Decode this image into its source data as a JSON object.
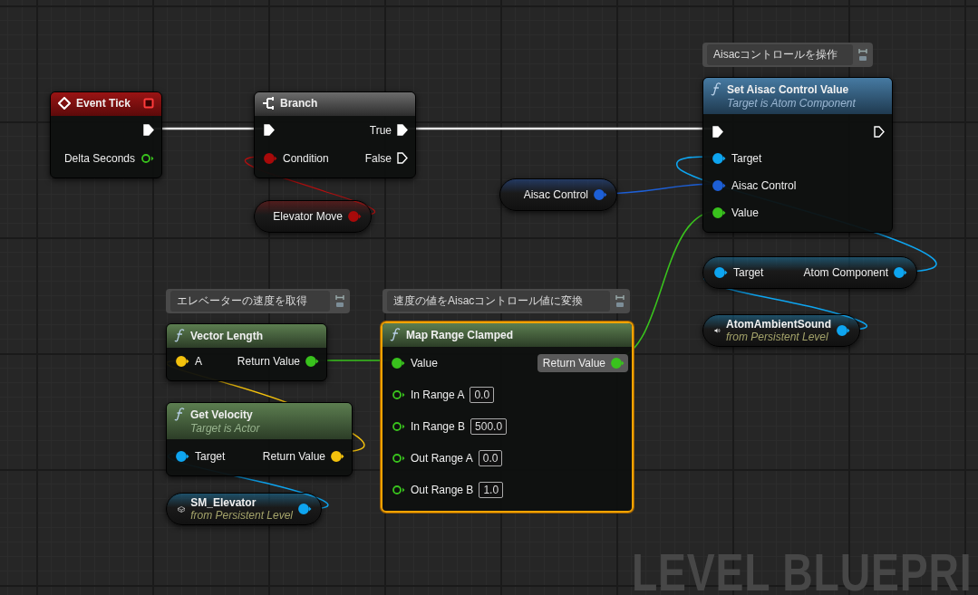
{
  "graph": {
    "comments": [
      {
        "text": "Aisacコントロールを操作"
      },
      {
        "text": "エレベーターの速度を取得"
      },
      {
        "text": "速度の値をAisacコントロール値に変換"
      }
    ],
    "nodes": [
      {
        "kind": "event",
        "title": "Event Tick",
        "selected": false,
        "outputs": [
          {
            "kind": "exec",
            "connected": true,
            "hovered": false
          },
          {
            "kind": "data",
            "label": "Delta Seconds",
            "color": "#39c21d",
            "connected": false,
            "hovered": false
          }
        ]
      },
      {
        "kind": "branch",
        "title": "Branch",
        "selected": false,
        "inputs": [
          {
            "kind": "exec",
            "connected": true,
            "hovered": false
          },
          {
            "kind": "data",
            "label": "Condition",
            "color": "#a80a0a",
            "connected": true,
            "hovered": false
          }
        ],
        "outputs": [
          {
            "kind": "exec",
            "label": "True",
            "connected": true,
            "hovered": false
          },
          {
            "kind": "exec",
            "label": "False",
            "connected": false,
            "hovered": false
          }
        ]
      },
      {
        "kind": "variable",
        "title": "Elevator Move",
        "selected": false,
        "outputs": [
          {
            "kind": "data",
            "color": "#a80a0a",
            "connected": true,
            "hovered": false
          }
        ]
      },
      {
        "kind": "function",
        "pure": false,
        "title": "Set Aisac Control Value",
        "subtitle": "Target is Atom Component",
        "selected": false,
        "inputs": [
          {
            "kind": "exec",
            "connected": true,
            "hovered": false
          },
          {
            "kind": "data",
            "label": "Target",
            "color": "#0ea5f0",
            "connected": true,
            "hovered": false
          },
          {
            "kind": "data",
            "label": "Aisac Control",
            "color": "#1d5fd6",
            "connected": true,
            "hovered": false
          },
          {
            "kind": "data",
            "label": "Value",
            "color": "#39c21d",
            "connected": true,
            "hovered": false
          }
        ],
        "outputs": [
          {
            "kind": "exec",
            "connected": false,
            "hovered": false
          }
        ]
      },
      {
        "kind": "variable",
        "title": "Aisac Control",
        "selected": false,
        "outputs": [
          {
            "kind": "data",
            "color": "#1d5fd6",
            "connected": true,
            "hovered": false
          }
        ]
      },
      {
        "kind": "getter",
        "selected": false,
        "inputs": [
          {
            "kind": "data",
            "label": "Target",
            "color": "#0ea5f0",
            "connected": true,
            "hovered": false
          }
        ],
        "outputs": [
          {
            "kind": "data",
            "label": "Atom Component",
            "color": "#0ea5f0",
            "connected": true,
            "hovered": false
          }
        ]
      },
      {
        "kind": "sound_reference",
        "title": "AtomAmbientSound",
        "subtitle": "from Persistent Level",
        "selected": false,
        "outputs": [
          {
            "kind": "data",
            "color": "#0ea5f0",
            "connected": true,
            "hovered": false
          }
        ]
      },
      {
        "kind": "function",
        "pure": true,
        "title": "Vector Length",
        "selected": false,
        "inputs": [
          {
            "kind": "data",
            "label": "A",
            "color": "#f4c20d",
            "connected": true,
            "hovered": false
          }
        ],
        "outputs": [
          {
            "kind": "data",
            "label": "Return Value",
            "color": "#39c21d",
            "connected": true,
            "hovered": false
          }
        ]
      },
      {
        "kind": "function",
        "pure": true,
        "title": "Get Velocity",
        "subtitle": "Target is Actor",
        "selected": false,
        "inputs": [
          {
            "kind": "data",
            "label": "Target",
            "color": "#0ea5f0",
            "connected": true,
            "hovered": false
          }
        ],
        "outputs": [
          {
            "kind": "data",
            "label": "Return Value",
            "color": "#f4c20d",
            "connected": true,
            "hovered": false
          }
        ]
      },
      {
        "kind": "mesh_reference",
        "title": "SM_Elevator",
        "subtitle": "from Persistent Level",
        "selected": false,
        "outputs": [
          {
            "kind": "data",
            "color": "#0ea5f0",
            "connected": true,
            "hovered": false
          }
        ]
      },
      {
        "kind": "function",
        "pure": true,
        "title": "Map Range Clamped",
        "selected": true,
        "inputs": [
          {
            "kind": "data",
            "label": "Value",
            "color": "#39c21d",
            "connected": true,
            "hovered": false
          },
          {
            "kind": "data",
            "label": "In Range A",
            "color": "#39c21d",
            "connected": false,
            "value": "0.0",
            "hovered": false
          },
          {
            "kind": "data",
            "label": "In Range B",
            "color": "#39c21d",
            "connected": false,
            "value": "500.0",
            "hovered": false
          },
          {
            "kind": "data",
            "label": "Out Range A",
            "color": "#39c21d",
            "connected": false,
            "value": "0.0",
            "hovered": false
          },
          {
            "kind": "data",
            "label": "Out Range B",
            "color": "#39c21d",
            "connected": false,
            "value": "1.0",
            "hovered": false
          }
        ],
        "outputs": [
          {
            "kind": "data",
            "label": "Return Value",
            "color": "#39c21d",
            "connected": true,
            "hovered": true
          }
        ]
      }
    ]
  },
  "graph_label": "LEVEL BLUEPRI"
}
